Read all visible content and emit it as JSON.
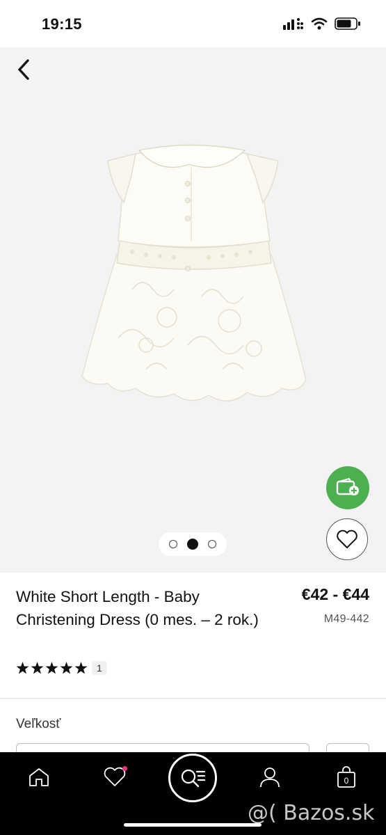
{
  "status_bar": {
    "time": "19:15"
  },
  "product": {
    "title": "White Short Length - Baby Christening Dress (0 mes. – 2 rok.)",
    "price": "€42 - €44",
    "sku": "M49-442",
    "rating": 5,
    "review_count": "1"
  },
  "gallery": {
    "image_count": 3,
    "active_index": 1
  },
  "options": {
    "size_label": "Veľkosť"
  },
  "nav": {
    "items": [
      "home-icon",
      "heart-icon",
      "search-list-icon",
      "user-icon",
      "bag-icon"
    ],
    "bag_count": "0"
  },
  "watermark": "@( Bazos.sk",
  "colors": {
    "accent_green": "#4caf50",
    "badge_pink": "#e6357a"
  }
}
